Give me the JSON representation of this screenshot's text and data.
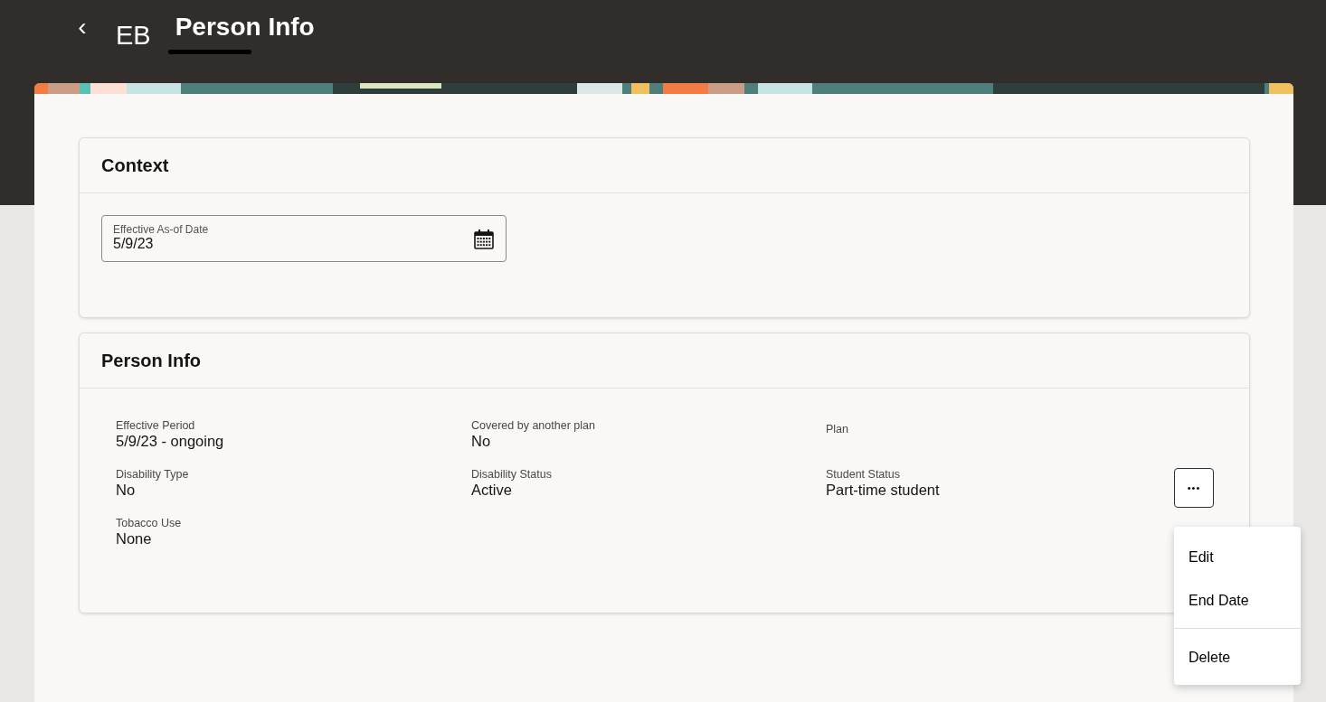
{
  "header": {
    "back": "‹",
    "initials": "EB",
    "title": "Person Info",
    "name_redacted": true
  },
  "context": {
    "title": "Context",
    "field": {
      "label": "Effective As-of Date",
      "value": "5/9/23"
    }
  },
  "person_info": {
    "title": "Person Info",
    "fields": [
      {
        "label": "Effective Period",
        "value": "5/9/23 - ongoing"
      },
      {
        "label": "Covered by another plan",
        "value": "No"
      },
      {
        "label": "Plan"
      },
      {
        "label": "Disability Type",
        "value": "No"
      },
      {
        "label": "Disability Status",
        "value": "Active"
      },
      {
        "label": "Student Status",
        "value": "Part-time student"
      },
      {
        "label": "Tobacco Use",
        "value": "None"
      }
    ],
    "more_button": {
      "label": "•••",
      "expanded": true
    },
    "menu": [
      {
        "label": "Edit"
      },
      {
        "label": "End Date"
      },
      {
        "label": "Delete",
        "divider_before": true
      }
    ]
  }
}
